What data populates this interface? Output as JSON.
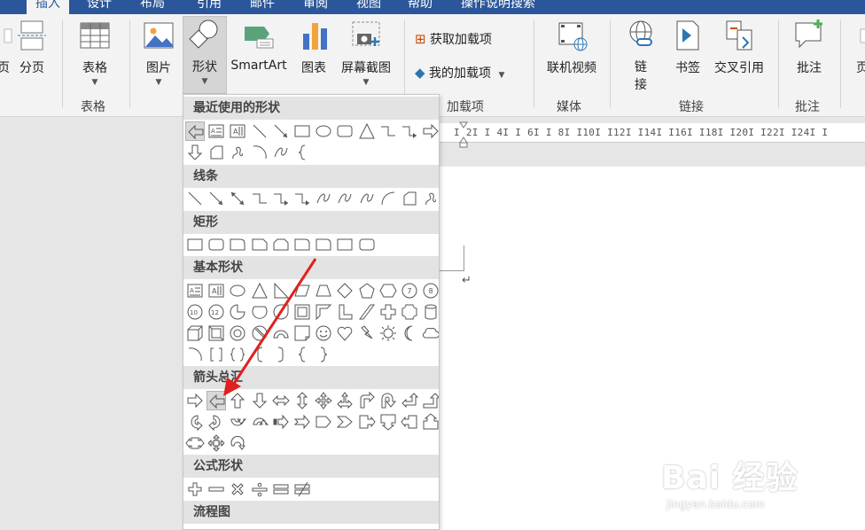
{
  "tabs": [
    "插入",
    "设计",
    "布局",
    "引用",
    "邮件",
    "审阅",
    "视图",
    "帮助",
    "操作说明搜索"
  ],
  "ribbon": {
    "pages_partial": "页",
    "page_break": "分页",
    "table": "表格",
    "picture": "图片",
    "shapes": "形状",
    "smartart": "SmartArt",
    "chart": "图表",
    "screenshot": "屏幕截图",
    "get_addins": "获取加载项",
    "my_addins": "我的加载项",
    "online_video": "联机视频",
    "link": "链接",
    "bookmark": "书签",
    "cross_ref": "交叉引用",
    "comment": "批注",
    "right_partial": "页",
    "groups": {
      "table": "表格",
      "addins": "加载项",
      "media": "媒体",
      "links": "链接",
      "comments": "批注"
    }
  },
  "ruler": "I  2I  I 4I  I 6I  I 8I  I10I  I12I  I14I  I16I  I18I  I20I  I22I  I24I  I",
  "para_mark": "↵",
  "shapes_menu": {
    "categories": [
      "最近使用的形状",
      "线条",
      "矩形",
      "基本形状",
      "箭头总汇",
      "公式形状",
      "流程图"
    ]
  },
  "watermark": {
    "brand": "Bai 经验",
    "url": "jingyan.baidu.com"
  },
  "colors": {
    "titlebar": "#2b579a",
    "ribbon": "#f3f3f3",
    "annotation": "#e02020"
  }
}
